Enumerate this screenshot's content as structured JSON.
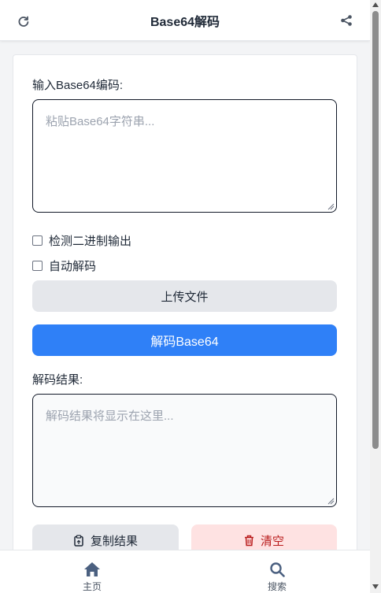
{
  "header": {
    "title": "Base64解码",
    "refresh_icon": "refresh-icon",
    "share_icon": "share-icon"
  },
  "input": {
    "label": "输入Base64编码:",
    "placeholder": "粘贴Base64字符串...",
    "value": ""
  },
  "options": {
    "detect_binary": {
      "label": "检测二进制输出",
      "checked": false
    },
    "auto_decode": {
      "label": "自动解码",
      "checked": false
    }
  },
  "buttons": {
    "upload": "上传文件",
    "decode": "解码Base64",
    "copy": "复制结果",
    "clear": "清空"
  },
  "result": {
    "label": "解码结果:",
    "placeholder": "解码结果将显示在这里...",
    "value": ""
  },
  "bottom_nav": {
    "items": [
      {
        "label": "主页",
        "icon": "home-icon"
      },
      {
        "label": "搜索",
        "icon": "search-icon"
      }
    ]
  },
  "colors": {
    "primary": "#2f80f7",
    "danger_bg": "#fee2e2",
    "danger_text": "#b91c1c",
    "secondary_bg": "#e5e7eb"
  }
}
